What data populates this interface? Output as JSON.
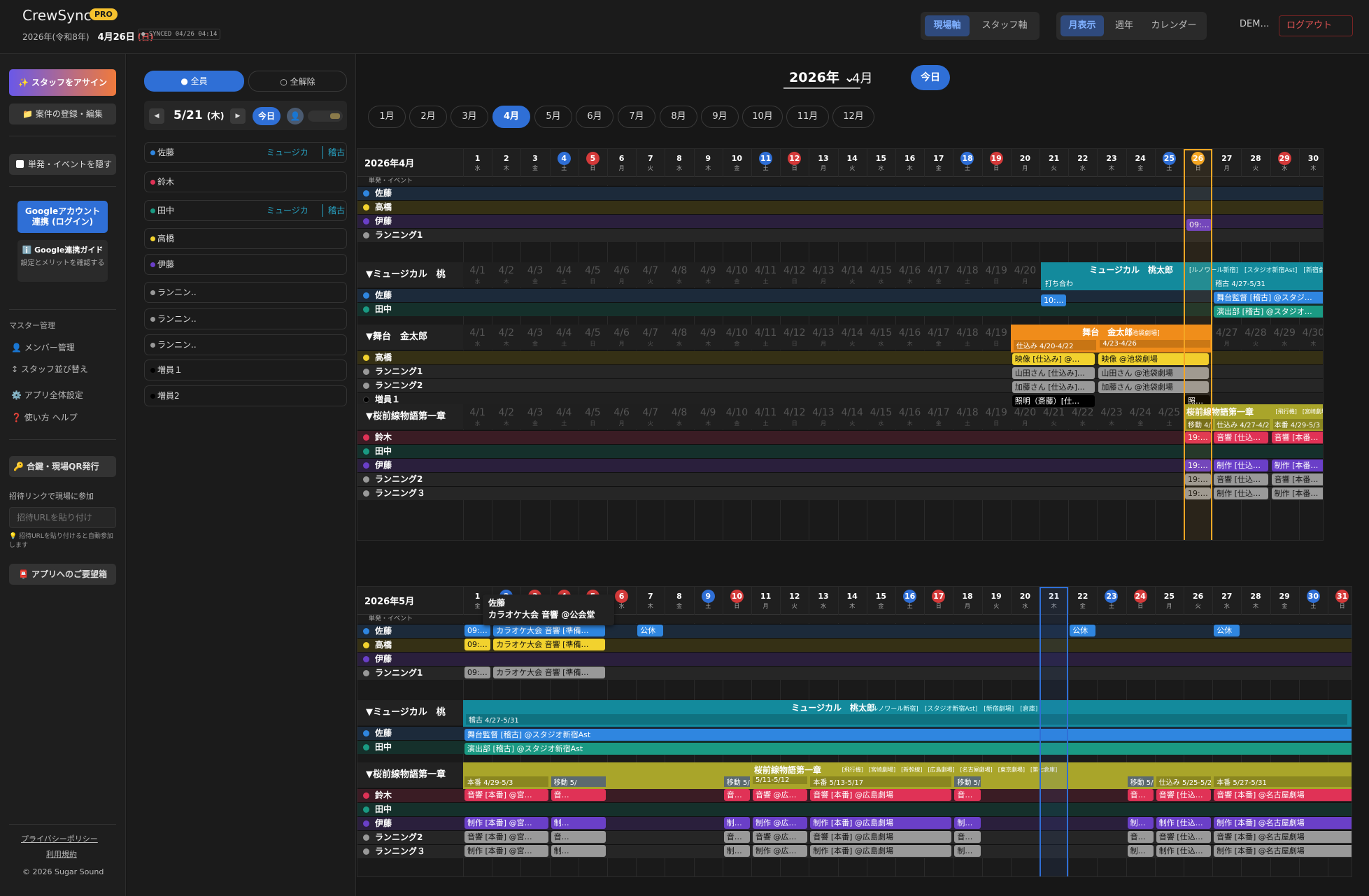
{
  "header": {
    "app_title": "CrewSync",
    "pro_badge": "PRO",
    "date_prefix": "2026年(令和8年)",
    "date_main": "4月26日",
    "date_wd": "(日)",
    "sync": "● SYNCED 04/26 04:14",
    "axis_site": "現場軸",
    "axis_staff": "スタッフ軸",
    "view_month": "月表示",
    "view_week": "週年",
    "view_calendar": "カレンダー",
    "user": "DEM…",
    "logout": "ログアウト"
  },
  "sidebar": {
    "assign": "✨ スタッフをアサイン",
    "register": "📁 案件の登録・編集",
    "hide_label": "単発・イベントを隠す",
    "google_link": "Googleアカウント\n連携 (ログイン)",
    "guide_title": "ℹ️ Google連携ガイド",
    "guide_desc": "設定とメリットを確認する",
    "master": "マスター管理",
    "members": "👤 メンバー管理",
    "sort": "↕ スタッフ並び替え",
    "settings": "⚙️ アプリ全体設定",
    "help": "❓ 使い方 ヘルプ",
    "qr": "🔑 合鍵・現場QR発行",
    "invite_label": "招待リンクで現場に参加",
    "invite_placeholder": "招待URLを貼り付け",
    "invite_hint": "💡 招待URLを貼り付けると自動参加します",
    "request": "📮 アプリへのご要望箱",
    "privacy": "プライバシーポリシー",
    "terms": "利用規約",
    "copyright": "© 2026 Sugar Sound"
  },
  "people_panel": {
    "all": "● 全員",
    "none": "○ 全解除",
    "date": "5/21",
    "date_wd": "(木)",
    "today": "今日",
    "people": [
      {
        "name": "佐藤",
        "color": "#2f86e0",
        "tag1": "ミュージカ",
        "tag2": "稽古"
      },
      {
        "name": "鈴木",
        "color": "#e03256",
        "tag1": "",
        "tag2": ""
      },
      {
        "name": "田中",
        "color": "#1a9a83",
        "tag1": "ミュージカ",
        "tag2": "稽古"
      },
      {
        "name": "高橋",
        "color": "#f2d22e",
        "tag1": "",
        "tag2": ""
      },
      {
        "name": "伊藤",
        "color": "#6a3fc8",
        "tag1": "",
        "tag2": ""
      },
      {
        "name": "ランニン..",
        "color": "#999999",
        "tag1": "",
        "tag2": ""
      },
      {
        "name": "ランニン..",
        "color": "#999999",
        "tag1": "",
        "tag2": ""
      },
      {
        "name": "ランニン..",
        "color": "#999999",
        "tag1": "",
        "tag2": ""
      },
      {
        "name": "増員１",
        "color": "#000000",
        "tag1": "",
        "tag2": ""
      },
      {
        "name": "増員2",
        "color": "#000000",
        "tag1": "",
        "tag2": ""
      }
    ]
  },
  "toolbar": {
    "year": "2026年 ⌄",
    "month": "4月",
    "today": "今日",
    "months": [
      "1月",
      "2月",
      "3月",
      "4月",
      "5月",
      "6月",
      "7月",
      "8月",
      "9月",
      "10月",
      "11月",
      "12月"
    ],
    "active_month": "4月"
  },
  "april": {
    "title": "2026年4月",
    "dates": [
      "1",
      "2",
      "3",
      "4",
      "5",
      "6",
      "7",
      "8",
      "9",
      "10",
      "11",
      "12",
      "13",
      "14",
      "15",
      "16",
      "17",
      "18",
      "19",
      "20",
      "21",
      "22",
      "23",
      "24",
      "25",
      "26",
      "27",
      "28",
      "29",
      "30"
    ],
    "weekdays": [
      "水",
      "木",
      "金",
      "土",
      "日",
      "月",
      "火",
      "水",
      "木",
      "金",
      "土",
      "日",
      "月",
      "火",
      "水",
      "木",
      "金",
      "土",
      "日",
      "月",
      "火",
      "水",
      "木",
      "金",
      "土",
      "日",
      "月",
      "火",
      "水",
      "木"
    ],
    "special": {
      "4": "#2f6fd6",
      "5": "#d43a3a",
      "11": "#2f6fd6",
      "12": "#d43a3a",
      "18": "#2f6fd6",
      "19": "#d43a3a",
      "25": "#2f6fd6",
      "26": "#f5a623",
      "29": "#d43a3a"
    },
    "ghost": [
      "4/1",
      "4/2",
      "4/3",
      "4/4",
      "4/5",
      "4/6",
      "4/7",
      "4/8",
      "4/9",
      "4/10",
      "4/11",
      "4/12",
      "4/13",
      "4/14",
      "4/15",
      "4/16",
      "4/17",
      "4/18",
      "4/19",
      "4/20",
      "4/21",
      "4/22",
      "4/23",
      "4/24",
      "4/25",
      "4/26",
      "4/27",
      "4/28",
      "4/29",
      "4/30"
    ],
    "event_label": "単発・イベント",
    "groups": [
      {
        "title": "",
        "rows": [
          {
            "name": "佐藤",
            "color": "#2f86e0",
            "bg": "#1c2a3a"
          },
          {
            "name": "高橋",
            "color": "#f2d22e",
            "bg": "#353015"
          },
          {
            "name": "伊藤",
            "color": "#6a3fc8",
            "bg": "#2a1f3c"
          },
          {
            "name": "ランニング1",
            "color": "#999999",
            "bg": "#262626"
          }
        ]
      },
      {
        "title": "▼ミュージカル　桃",
        "rows": [
          {
            "name": "佐藤",
            "color": "#2f86e0",
            "bg": "#1c2a3a"
          },
          {
            "name": "田中",
            "color": "#1a9a83",
            "bg": "#15302b"
          }
        ]
      },
      {
        "title": "▼舞台　金太郎",
        "rows": [
          {
            "name": "高橋",
            "color": "#f2d22e",
            "bg": "#353015"
          },
          {
            "name": "ランニング1",
            "color": "#999999",
            "bg": "#262626"
          },
          {
            "name": "ランニング2",
            "color": "#999999",
            "bg": "#262626"
          },
          {
            "name": "増員１",
            "color": "#000000",
            "bg": "#202020"
          }
        ]
      },
      {
        "title": "▼桜前線物語第一章",
        "rows": [
          {
            "name": "鈴木",
            "color": "#e03256",
            "bg": "#3a1c24"
          },
          {
            "name": "田中",
            "color": "#1a9a83",
            "bg": "#15302b"
          },
          {
            "name": "伊藤",
            "color": "#6a3fc8",
            "bg": "#2a1f3c"
          },
          {
            "name": "ランニング2",
            "color": "#999999",
            "bg": "#262626"
          },
          {
            "name": "ランニング３",
            "color": "#999999",
            "bg": "#262626"
          }
        ]
      }
    ],
    "events": {
      "ito_0926": "09:…",
      "sato_1017": "10:…",
      "musical_band": "ミュージカル　桃太郎",
      "musical_tags": "[ルノワール新宿]　[スタジオ新宿Ast]　[新宿劇場]　[倉庫]",
      "musical_sub1": "打ち合わ",
      "musical_sub2": "稽古 4/27-5/31",
      "sato_stage": "舞台監督 [稽古] @スタジ…",
      "tanaka_prod": "演出部 [稽古] @スタジオ…",
      "kintaro_band": "舞台　金太郎",
      "kintaro_tag": "[池袋劇場]",
      "kintaro_s1": "仕込み 4/20-4/22",
      "kintaro_s2": "4/23-4/26",
      "takahashi_a": "映像 [仕込み] @…",
      "takahashi_b": "映像 @池袋劇場",
      "r1_a": "山田さん [仕込み]…",
      "r1_b": "山田さん @池袋劇場",
      "r2_a": "加藤さん [仕込み]…",
      "r2_b": "加藤さん @池袋劇場",
      "extra_a": "照明（斎藤）[仕…",
      "extra_b": "照…",
      "sakura_band": "桜前線物語第一章",
      "sakura_tags": "[飛行機]　[宮崎劇場]",
      "sakura_s1": "移動 4/",
      "sakura_s2": "仕込み 4/27-4/2",
      "sakura_s3": "本番 4/29-5/3",
      "suzuki_a": "19:…",
      "suzuki_b": "音響 [仕込…",
      "suzuki_c": "音響 [本番…",
      "ito_a": "19:…",
      "ito_b": "制作 [仕込…",
      "ito_c": "制作 [本番…",
      "r2s_a": "19:…",
      "r2s_b": "音響 [仕込…",
      "r2s_c": "音響 [本番…",
      "r3s_a": "19:…",
      "r3s_b": "制作 [仕込…",
      "r3s_c": "制作 [本番…"
    }
  },
  "may": {
    "title": "2026年5月",
    "dates": [
      "1",
      "2",
      "3",
      "4",
      "5",
      "6",
      "7",
      "8",
      "9",
      "10",
      "11",
      "12",
      "13",
      "14",
      "15",
      "16",
      "17",
      "18",
      "19",
      "20",
      "21",
      "22",
      "23",
      "24",
      "25",
      "26",
      "27",
      "28",
      "29",
      "30",
      "31"
    ],
    "weekdays": [
      "金",
      "土",
      "日",
      "月",
      "火",
      "水",
      "木",
      "金",
      "土",
      "日",
      "月",
      "火",
      "水",
      "木",
      "金",
      "土",
      "日",
      "月",
      "火",
      "水",
      "木",
      "金",
      "土",
      "日",
      "月",
      "火",
      "水",
      "木",
      "金",
      "土",
      "日"
    ],
    "special": {
      "2": "#2f6fd6",
      "3": "#d43a3a",
      "4": "#d43a3a",
      "5": "#d43a3a",
      "6": "#d43a3a",
      "9": "#2f6fd6",
      "10": "#d43a3a",
      "16": "#2f6fd6",
      "17": "#d43a3a",
      "23": "#2f6fd6",
      "24": "#d43a3a",
      "30": "#2f6fd6",
      "31": "#d43a3a"
    },
    "event_label": "単発・イベント",
    "tooltip_name": "佐藤",
    "tooltip_text": "カラオケ大会 音響 @公会堂",
    "groups": [
      {
        "title": "",
        "rows": [
          {
            "name": "佐藤",
            "color": "#2f86e0",
            "bg": "#1c2a3a"
          },
          {
            "name": "高橋",
            "color": "#f2d22e",
            "bg": "#353015"
          },
          {
            "name": "伊藤",
            "color": "#6a3fc8",
            "bg": "#2a1f3c"
          },
          {
            "name": "ランニング1",
            "color": "#999999",
            "bg": "#262626"
          }
        ]
      },
      {
        "title": "▼ミュージカル　桃",
        "rows": [
          {
            "name": "佐藤",
            "color": "#2f86e0",
            "bg": "#1c2a3a"
          },
          {
            "name": "田中",
            "color": "#1a9a83",
            "bg": "#15302b"
          }
        ]
      },
      {
        "title": "▼桜前線物語第一章",
        "rows": [
          {
            "name": "鈴木",
            "color": "#e03256",
            "bg": "#3a1c24"
          },
          {
            "name": "田中",
            "color": "#1a9a83",
            "bg": "#15302b"
          },
          {
            "name": "伊藤",
            "color": "#6a3fc8",
            "bg": "#2a1f3c"
          },
          {
            "name": "ランニング2",
            "color": "#999999",
            "bg": "#262626"
          },
          {
            "name": "ランニング３",
            "color": "#999999",
            "bg": "#262626"
          }
        ]
      }
    ],
    "events": {
      "time": "09:…",
      "karaoke": "カラオケ大会 音響 [準備…",
      "off": "公休",
      "musical_band": "ミュージカル　桃太郎",
      "musical_tags": "[ルノワール新宿]　[スタジオ新宿Ast]　[新宿劇場]　[倉庫]",
      "musical_sub": "稽古 4/27-5/31",
      "sato_full": "舞台監督 [稽古] @スタジオ新宿Ast",
      "tanaka_full": "演出部 [稽古] @スタジオ新宿Ast",
      "sakura_band": "桜前線物語第一章",
      "sakura_tags": "[飛行機]　[宮崎劇場]　[新幹線]　[広島劇場]　[名古屋劇場]　[東京劇場]　[第七倉庫]",
      "s_a": "本番 4/29-5/3",
      "s_b": "移動 5/",
      "s_c": "移動 5/",
      "s_d": "5/11-5/12",
      "s_e": "本番 5/13-5/17",
      "s_f": "移動 5/",
      "s_g": "移動 5/",
      "s_h": "仕込み 5/25-5/2",
      "s_i": "本番 5/27-5/31",
      "suzuki": [
        "音響 [本番] @宮…",
        "音…",
        "音…",
        "音響 @広…",
        "音響 [本番] @広島劇場",
        "音…",
        "音…",
        "音響 [仕込…",
        "音響 [本番] @名古屋劇場"
      ],
      "ito": [
        "制作 [本番] @宮…",
        "制…",
        "制…",
        "制作 @広…",
        "制作 [本番] @広島劇場",
        "制…",
        "制…",
        "制作 [仕込…",
        "制作 [本番] @名古屋劇場"
      ],
      "r2": [
        "音響 [本番] @宮…",
        "音…",
        "音…",
        "音響 @広…",
        "音響 [本番] @広島劇場",
        "音…",
        "音…",
        "音響 [仕込…",
        "音響 [本番] @名古屋劇場"
      ],
      "r3": [
        "制作 [本番] @宮…",
        "制…",
        "制…",
        "制作 @広…",
        "制作 [本番] @広島劇場",
        "制…",
        "制…",
        "制作 [仕込…",
        "制作 [本番] @名古屋劇場"
      ]
    }
  },
  "colors": {
    "accent": "#2f6fd6",
    "sat": "#2f6fd6",
    "sun": "#d43a3a",
    "today": "#f5a623",
    "musical": "#138a9c",
    "kintaro": "#f08c1a",
    "sakura": "#a9a52a"
  }
}
